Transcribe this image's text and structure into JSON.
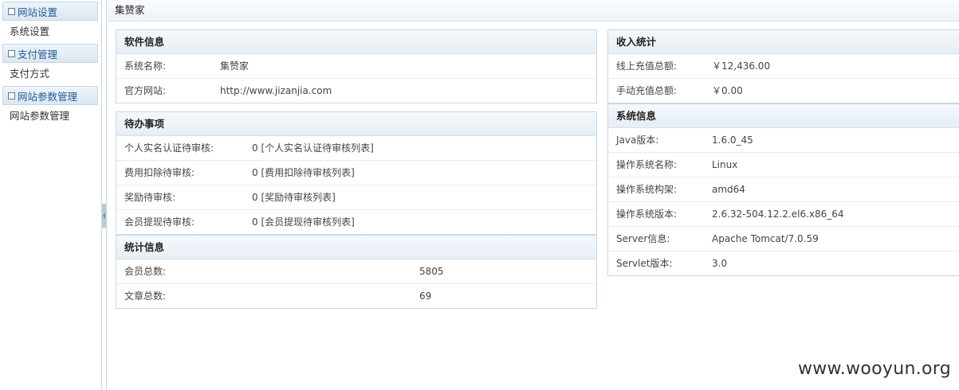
{
  "sidebar": {
    "groups": [
      {
        "label": "网站设置",
        "items": [
          "系统设置"
        ]
      },
      {
        "label": "支付管理",
        "items": [
          "支付方式"
        ]
      },
      {
        "label": "网站参数管理",
        "items": [
          "网站参数管理"
        ]
      }
    ]
  },
  "header": {
    "title": "集赞家"
  },
  "software": {
    "title": "软件信息",
    "rows": [
      {
        "label": "系统名称:",
        "value": "集赞家"
      },
      {
        "label": "官方网站:",
        "value": "http://www.jizanjia.com"
      }
    ]
  },
  "todo": {
    "title": "待办事项",
    "rows": [
      {
        "label": "个人实名认证待审核:",
        "count": "0",
        "link": "[个人实名认证待审核列表]"
      },
      {
        "label": "费用扣除待审核:",
        "count": "0",
        "link": "[费用扣除待审核列表]"
      },
      {
        "label": "奖励待审核:",
        "count": "0",
        "link": "[奖励待审核列表]"
      },
      {
        "label": "会员提现待审核:",
        "count": "0",
        "link": "[会员提现待审核列表]"
      }
    ]
  },
  "stats": {
    "title": "统计信息",
    "rows": [
      {
        "label": "会员总数:",
        "value": "5805"
      },
      {
        "label": "文章总数:",
        "value": "69"
      }
    ]
  },
  "income": {
    "title": "收入统计",
    "rows": [
      {
        "label": "线上充值总额:",
        "value": "￥12,436.00"
      },
      {
        "label": "手动充值总额:",
        "value": "￥0.00"
      }
    ]
  },
  "system": {
    "title": "系统信息",
    "rows": [
      {
        "label": "Java版本:",
        "value": "1.6.0_45"
      },
      {
        "label": "操作系统名称:",
        "value": "Linux"
      },
      {
        "label": "操作系统构架:",
        "value": "amd64"
      },
      {
        "label": "操作系统版本:",
        "value": "2.6.32-504.12.2.el6.x86_64"
      },
      {
        "label": "Server信息:",
        "value": "Apache Tomcat/7.0.59"
      },
      {
        "label": "Servlet版本:",
        "value": "3.0"
      }
    ]
  },
  "watermark": "www.wooyun.org"
}
